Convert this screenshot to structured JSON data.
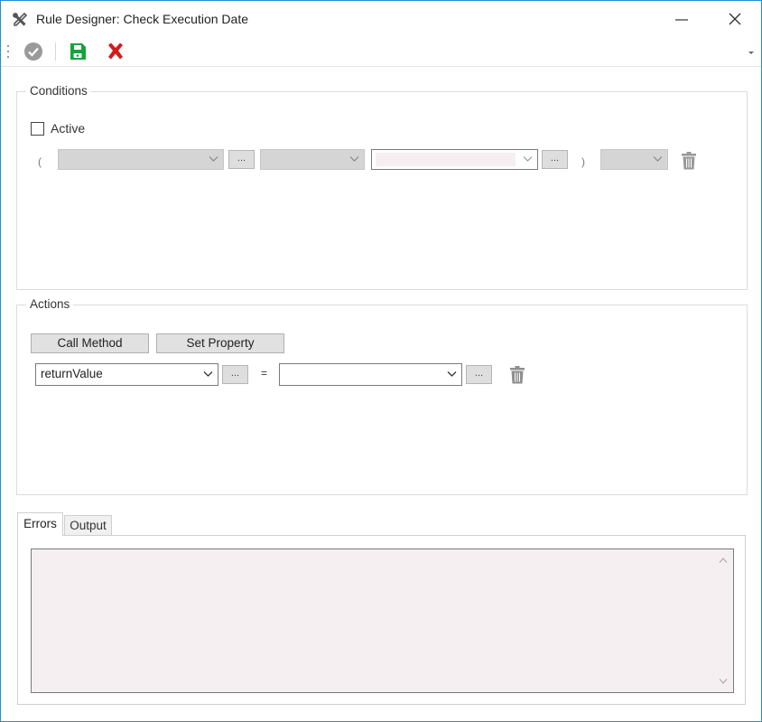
{
  "window": {
    "title": "Rule Designer: Check Execution Date",
    "minimize_icon": "minimize-icon",
    "close_icon": "close-icon",
    "accent": "#1f8fd8"
  },
  "toolbar": {
    "validate_icon": "check-circle-icon",
    "save_icon": "save-icon",
    "cancel_icon": "red-x-icon",
    "save_color": "#14a33a",
    "cancel_color": "#d21b1b"
  },
  "conditions": {
    "title": "Conditions",
    "active_label": "Active",
    "active_checked": false,
    "open_paren": "(",
    "close_paren": ")",
    "ellipsis_label": "..."
  },
  "actions": {
    "title": "Actions",
    "call_method_label": "Call Method",
    "set_property_label": "Set Property",
    "target_value": "returnValue",
    "equals": "=",
    "value": "",
    "ellipsis_label": "..."
  },
  "tabs": [
    {
      "label": "Errors",
      "active": true
    },
    {
      "label": "Output",
      "active": false
    }
  ],
  "errors_text": ""
}
